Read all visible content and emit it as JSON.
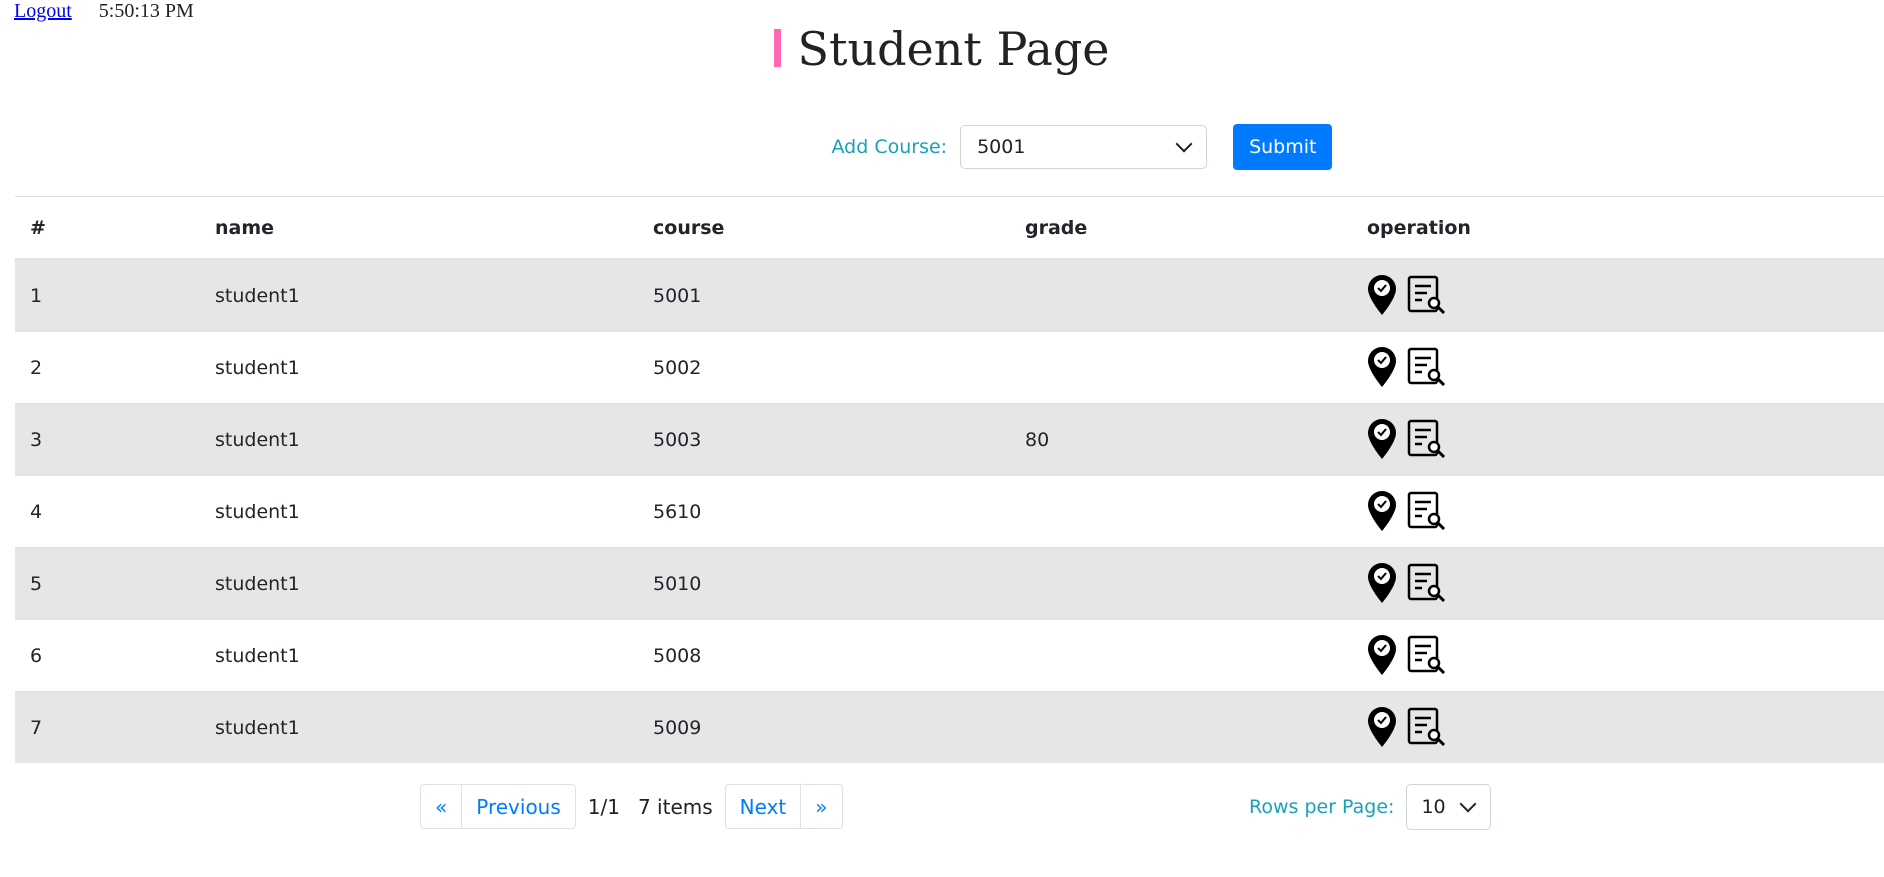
{
  "topbar": {
    "logout_label": "Logout",
    "clock": "5:50:13 PM"
  },
  "page": {
    "title": "Student Page",
    "accent_color": "#ff69b4"
  },
  "add_course": {
    "label": "Add Course:",
    "selected": "5001",
    "submit_label": "Submit",
    "button_color": "#007bff"
  },
  "table": {
    "headers": [
      "#",
      "name",
      "course",
      "grade",
      "operation"
    ],
    "rows": [
      {
        "idx": "1",
        "name": "student1",
        "course": "5001",
        "grade": ""
      },
      {
        "idx": "2",
        "name": "student1",
        "course": "5002",
        "grade": ""
      },
      {
        "idx": "3",
        "name": "student1",
        "course": "5003",
        "grade": "80"
      },
      {
        "idx": "4",
        "name": "student1",
        "course": "5610",
        "grade": ""
      },
      {
        "idx": "5",
        "name": "student1",
        "course": "5010",
        "grade": ""
      },
      {
        "idx": "6",
        "name": "student1",
        "course": "5008",
        "grade": ""
      },
      {
        "idx": "7",
        "name": "student1",
        "course": "5009",
        "grade": ""
      }
    ],
    "operation_icons": [
      "location-check-icon",
      "document-search-icon"
    ]
  },
  "pagination": {
    "first": "«",
    "prev": "Previous",
    "page": "1/1",
    "items": "7 items",
    "next": "Next",
    "last": "»"
  },
  "rows_per_page": {
    "label": "Rows per Page:",
    "value": "10"
  }
}
